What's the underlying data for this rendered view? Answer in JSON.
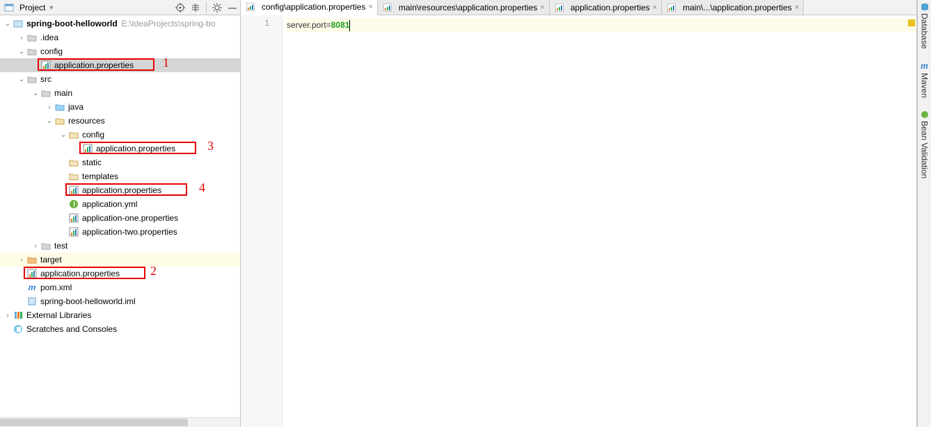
{
  "project_panel": {
    "title": "Project",
    "root": {
      "name": "spring-boot-helloworld",
      "path": "E:\\IdeaProjects\\spring-bo"
    },
    "tree": {
      "idea": ".idea",
      "config": "config",
      "config_app": "application.properties",
      "src": "src",
      "main": "main",
      "java": "java",
      "resources": "resources",
      "res_config": "config",
      "res_config_app": "application.properties",
      "static": "static",
      "templates": "templates",
      "res_app": "application.properties",
      "app_yml": "application.yml",
      "app_one": "application-one.properties",
      "app_two": "application-two.properties",
      "test": "test",
      "target": "target",
      "target_app": "application.properties",
      "pom": "pom.xml",
      "iml": "spring-boot-helloworld.iml",
      "ext_lib": "External Libraries",
      "scratches": "Scratches and Consoles"
    },
    "annotations": {
      "n1": "1",
      "n2": "2",
      "n3": "3",
      "n4": "4"
    }
  },
  "tabs": [
    {
      "label": "config\\application.properties",
      "active": true
    },
    {
      "label": "main\\resources\\application.properties",
      "active": false
    },
    {
      "label": "application.properties",
      "active": false
    },
    {
      "label": "main\\...\\application.properties",
      "active": false
    }
  ],
  "editor": {
    "line_no": "1",
    "code": {
      "key": "server.port",
      "eq": "=",
      "val": "8081"
    }
  },
  "tool_windows": {
    "database": "Database",
    "maven": "Maven",
    "bean": "Bean Validation"
  }
}
